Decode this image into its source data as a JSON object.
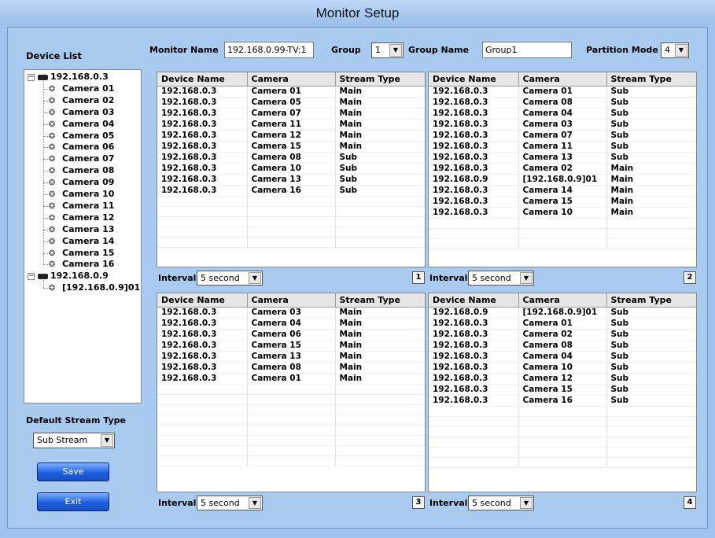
{
  "window": {
    "title": "Monitor Setup"
  },
  "device_list": {
    "label": "Device List",
    "devices": [
      {
        "name": "192.168.0.3",
        "cameras": [
          "Camera 01",
          "Camera 02",
          "Camera 03",
          "Camera 04",
          "Camera 05",
          "Camera 06",
          "Camera 07",
          "Camera 08",
          "Camera 09",
          "Camera 10",
          "Camera 11",
          "Camera 12",
          "Camera 13",
          "Camera 14",
          "Camera 15",
          "Camera 16"
        ]
      },
      {
        "name": "192.168.0.9",
        "cameras": [
          "[192.168.0.9]01"
        ]
      }
    ]
  },
  "toolbar": {
    "monitor_name_label": "Monitor Name",
    "monitor_name_value": "192.168.0.99-TV:1",
    "group_label": "Group",
    "group_value": "1",
    "group_name_label": "Group Name",
    "group_name_value": "Group1",
    "partition_label": "Partition Mode",
    "partition_value": "4"
  },
  "grid_columns": [
    "Device Name",
    "Camera",
    "Stream Type"
  ],
  "panels": [
    {
      "number": "1",
      "interval_label": "Interval",
      "interval_value": "5 second",
      "rows": [
        [
          "192.168.0.3",
          "Camera 01",
          "Main"
        ],
        [
          "192.168.0.3",
          "Camera 05",
          "Main"
        ],
        [
          "192.168.0.3",
          "Camera 07",
          "Main"
        ],
        [
          "192.168.0.3",
          "Camera 11",
          "Main"
        ],
        [
          "192.168.0.3",
          "Camera 12",
          "Main"
        ],
        [
          "192.168.0.3",
          "Camera 15",
          "Main"
        ],
        [
          "192.168.0.3",
          "Camera 08",
          "Sub"
        ],
        [
          "192.168.0.3",
          "Camera 10",
          "Sub"
        ],
        [
          "192.168.0.3",
          "Camera 13",
          "Sub"
        ],
        [
          "192.168.0.3",
          "Camera 16",
          "Sub"
        ]
      ]
    },
    {
      "number": "2",
      "interval_label": "Interval",
      "interval_value": "5 second",
      "rows": [
        [
          "192.168.0.3",
          "Camera 01",
          "Sub"
        ],
        [
          "192.168.0.3",
          "Camera 08",
          "Sub"
        ],
        [
          "192.168.0.3",
          "Camera 04",
          "Sub"
        ],
        [
          "192.168.0.3",
          "Camera 03",
          "Sub"
        ],
        [
          "192.168.0.3",
          "Camera 07",
          "Sub"
        ],
        [
          "192.168.0.3",
          "Camera 11",
          "Sub"
        ],
        [
          "192.168.0.3",
          "Camera 13",
          "Sub"
        ],
        [
          "192.168.0.3",
          "Camera 02",
          "Main"
        ],
        [
          "192.168.0.9",
          "[192.168.0.9]01",
          "Main"
        ],
        [
          "192.168.0.3",
          "Camera 14",
          "Main"
        ],
        [
          "192.168.0.3",
          "Camera 15",
          "Main"
        ],
        [
          "192.168.0.3",
          "Camera 10",
          "Main"
        ]
      ]
    },
    {
      "number": "3",
      "interval_label": "Interval",
      "interval_value": "5 second",
      "rows": [
        [
          "192.168.0.3",
          "Camera 03",
          "Main"
        ],
        [
          "192.168.0.3",
          "Camera 04",
          "Main"
        ],
        [
          "192.168.0.3",
          "Camera 06",
          "Main"
        ],
        [
          "192.168.0.3",
          "Camera 15",
          "Main"
        ],
        [
          "192.168.0.3",
          "Camera 13",
          "Main"
        ],
        [
          "192.168.0.3",
          "Camera 08",
          "Main"
        ],
        [
          "192.168.0.3",
          "Camera 01",
          "Main"
        ]
      ]
    },
    {
      "number": "4",
      "interval_label": "Interval",
      "interval_value": "5 second",
      "rows": [
        [
          "192.168.0.9",
          "[192.168.0.9]01",
          "Sub"
        ],
        [
          "192.168.0.3",
          "Camera 01",
          "Sub"
        ],
        [
          "192.168.0.3",
          "Camera 02",
          "Sub"
        ],
        [
          "192.168.0.3",
          "Camera 08",
          "Sub"
        ],
        [
          "192.168.0.3",
          "Camera 04",
          "Sub"
        ],
        [
          "192.168.0.3",
          "Camera 10",
          "Sub"
        ],
        [
          "192.168.0.3",
          "Camera 12",
          "Sub"
        ],
        [
          "192.168.0.3",
          "Camera 15",
          "Sub"
        ],
        [
          "192.168.0.3",
          "Camera 16",
          "Sub"
        ]
      ]
    }
  ],
  "default_stream": {
    "label": "Default Stream Type",
    "value": "Sub Stream"
  },
  "buttons": {
    "save": "Save",
    "exit": "Exit"
  },
  "icons": {
    "device": "dvr-device-icon",
    "camera": "camera-icon",
    "dropdown": "chevron-down-icon"
  }
}
